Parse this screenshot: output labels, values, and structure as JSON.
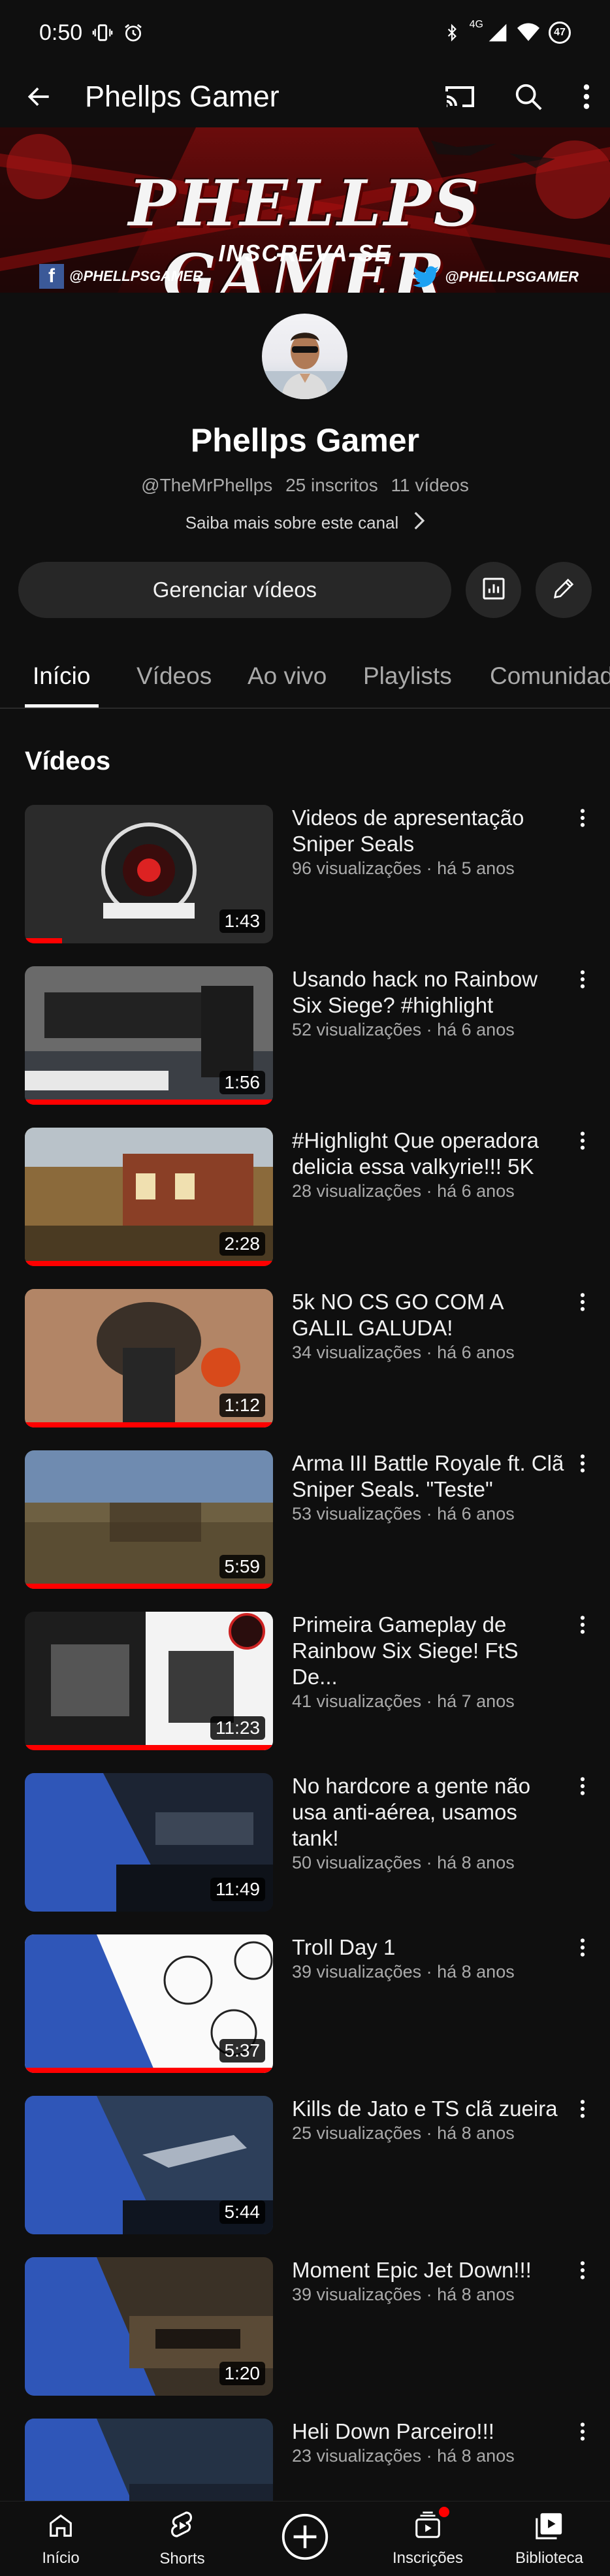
{
  "status_bar": {
    "time": "0:50",
    "network": "4G",
    "battery": "47"
  },
  "app_bar": {
    "title": "Phellps Gamer"
  },
  "banner": {
    "title": "PHELLPS GAMER",
    "subtitle": "INSCREVA-SE",
    "facebook_handle": "@PHELLPSGAMER",
    "twitter_handle": "@PHELLPSGAMER"
  },
  "channel": {
    "name": "Phellps Gamer",
    "handle": "@TheMrPhellps",
    "subscribers": "25 inscritos",
    "videos_count": "11 vídeos",
    "more_info": "Saiba mais sobre este canal"
  },
  "actions": {
    "manage_videos": "Gerenciar vídeos"
  },
  "tabs": [
    {
      "label": "Início",
      "active": true
    },
    {
      "label": "Vídeos",
      "active": false
    },
    {
      "label": "Ao vivo",
      "active": false
    },
    {
      "label": "Playlists",
      "active": false
    },
    {
      "label": "Comunidade",
      "active": false
    }
  ],
  "section_title": "Vídeos",
  "videos": [
    {
      "title": "Videos de apresentação Sniper Seals",
      "meta": "96 visualizações · há 5 anos",
      "duration": "1:43",
      "watched": 0.15
    },
    {
      "title": "Usando hack no Rainbow Six Siege? #highlight",
      "meta": "52 visualizações · há 6 anos",
      "duration": "1:56",
      "watched": 1.0
    },
    {
      "title": "#Highlight Que operadora delicia essa valkyrie!!! 5K",
      "meta": "28 visualizações · há 6 anos",
      "duration": "2:28",
      "watched": 1.0
    },
    {
      "title": "5k NO CS GO COM A GALIL GALUDA!",
      "meta": "34 visualizações · há 6 anos",
      "duration": "1:12",
      "watched": 1.0
    },
    {
      "title": "Arma III Battle Royale ft. Clã Sniper Seals. \"Teste\"",
      "meta": "53 visualizações · há 6 anos",
      "duration": "5:59",
      "watched": 1.0
    },
    {
      "title": "Primeira Gameplay de Rainbow Six Siege! FtS De...",
      "meta": "41 visualizações · há 7 anos",
      "duration": "11:23",
      "watched": 1.0
    },
    {
      "title": "No hardcore a gente não usa anti-aérea, usamos tank!",
      "meta": "50 visualizações · há 8 anos",
      "duration": "11:49",
      "watched": 0.0
    },
    {
      "title": "Troll Day 1",
      "meta": "39 visualizações · há 8 anos",
      "duration": "5:37",
      "watched": 1.0
    },
    {
      "title": "Kills de Jato e TS clã zueira",
      "meta": "25 visualizações · há 8 anos",
      "duration": "5:44",
      "watched": 0.0
    },
    {
      "title": "Moment Epic Jet Down!!!",
      "meta": "39 visualizações · há 8 anos",
      "duration": "1:20",
      "watched": 0.0
    },
    {
      "title": "Heli Down Parceiro!!!",
      "meta": "23 visualizações · há 8 anos",
      "duration": "",
      "watched": 0.0
    }
  ],
  "bottom_nav": [
    {
      "label": "Início",
      "icon": "home-icon"
    },
    {
      "label": "Shorts",
      "icon": "shorts-icon"
    },
    {
      "label": "",
      "icon": "create-icon"
    },
    {
      "label": "Inscrições",
      "icon": "subscriptions-icon"
    },
    {
      "label": "Biblioteca",
      "icon": "library-icon"
    }
  ]
}
